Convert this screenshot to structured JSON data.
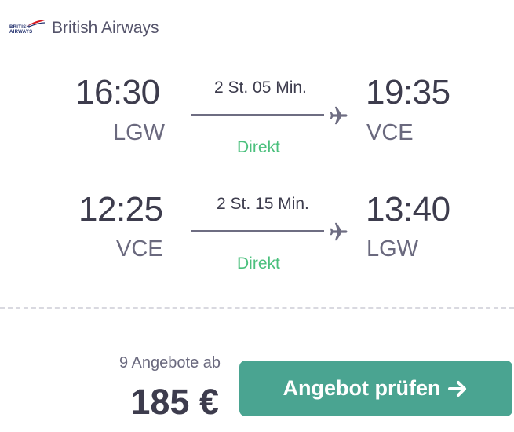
{
  "airline": {
    "name": "British Airways",
    "logo_line1": "BRITISH",
    "logo_line2": "AIRWAYS",
    "logo_colors": [
      "#1f2d6b",
      "#d71920"
    ]
  },
  "legs": [
    {
      "departure_time": "16:30",
      "departure_airport": "LGW",
      "duration": "2 St. 05 Min.",
      "stops": "Direkt",
      "arrival_time": "19:35",
      "arrival_airport": "VCE"
    },
    {
      "departure_time": "12:25",
      "departure_airport": "VCE",
      "duration": "2 St. 15 Min.",
      "stops": "Direkt",
      "arrival_time": "13:40",
      "arrival_airport": "LGW"
    }
  ],
  "offers": {
    "count_label": "9 Angebote ab",
    "price": "185 €"
  },
  "cta": {
    "label": "Angebot prüfen",
    "icon": "arrow-right-icon",
    "color": "#4aa491"
  },
  "colors": {
    "direct": "#4bc07d",
    "text": "#3d3c4d"
  }
}
